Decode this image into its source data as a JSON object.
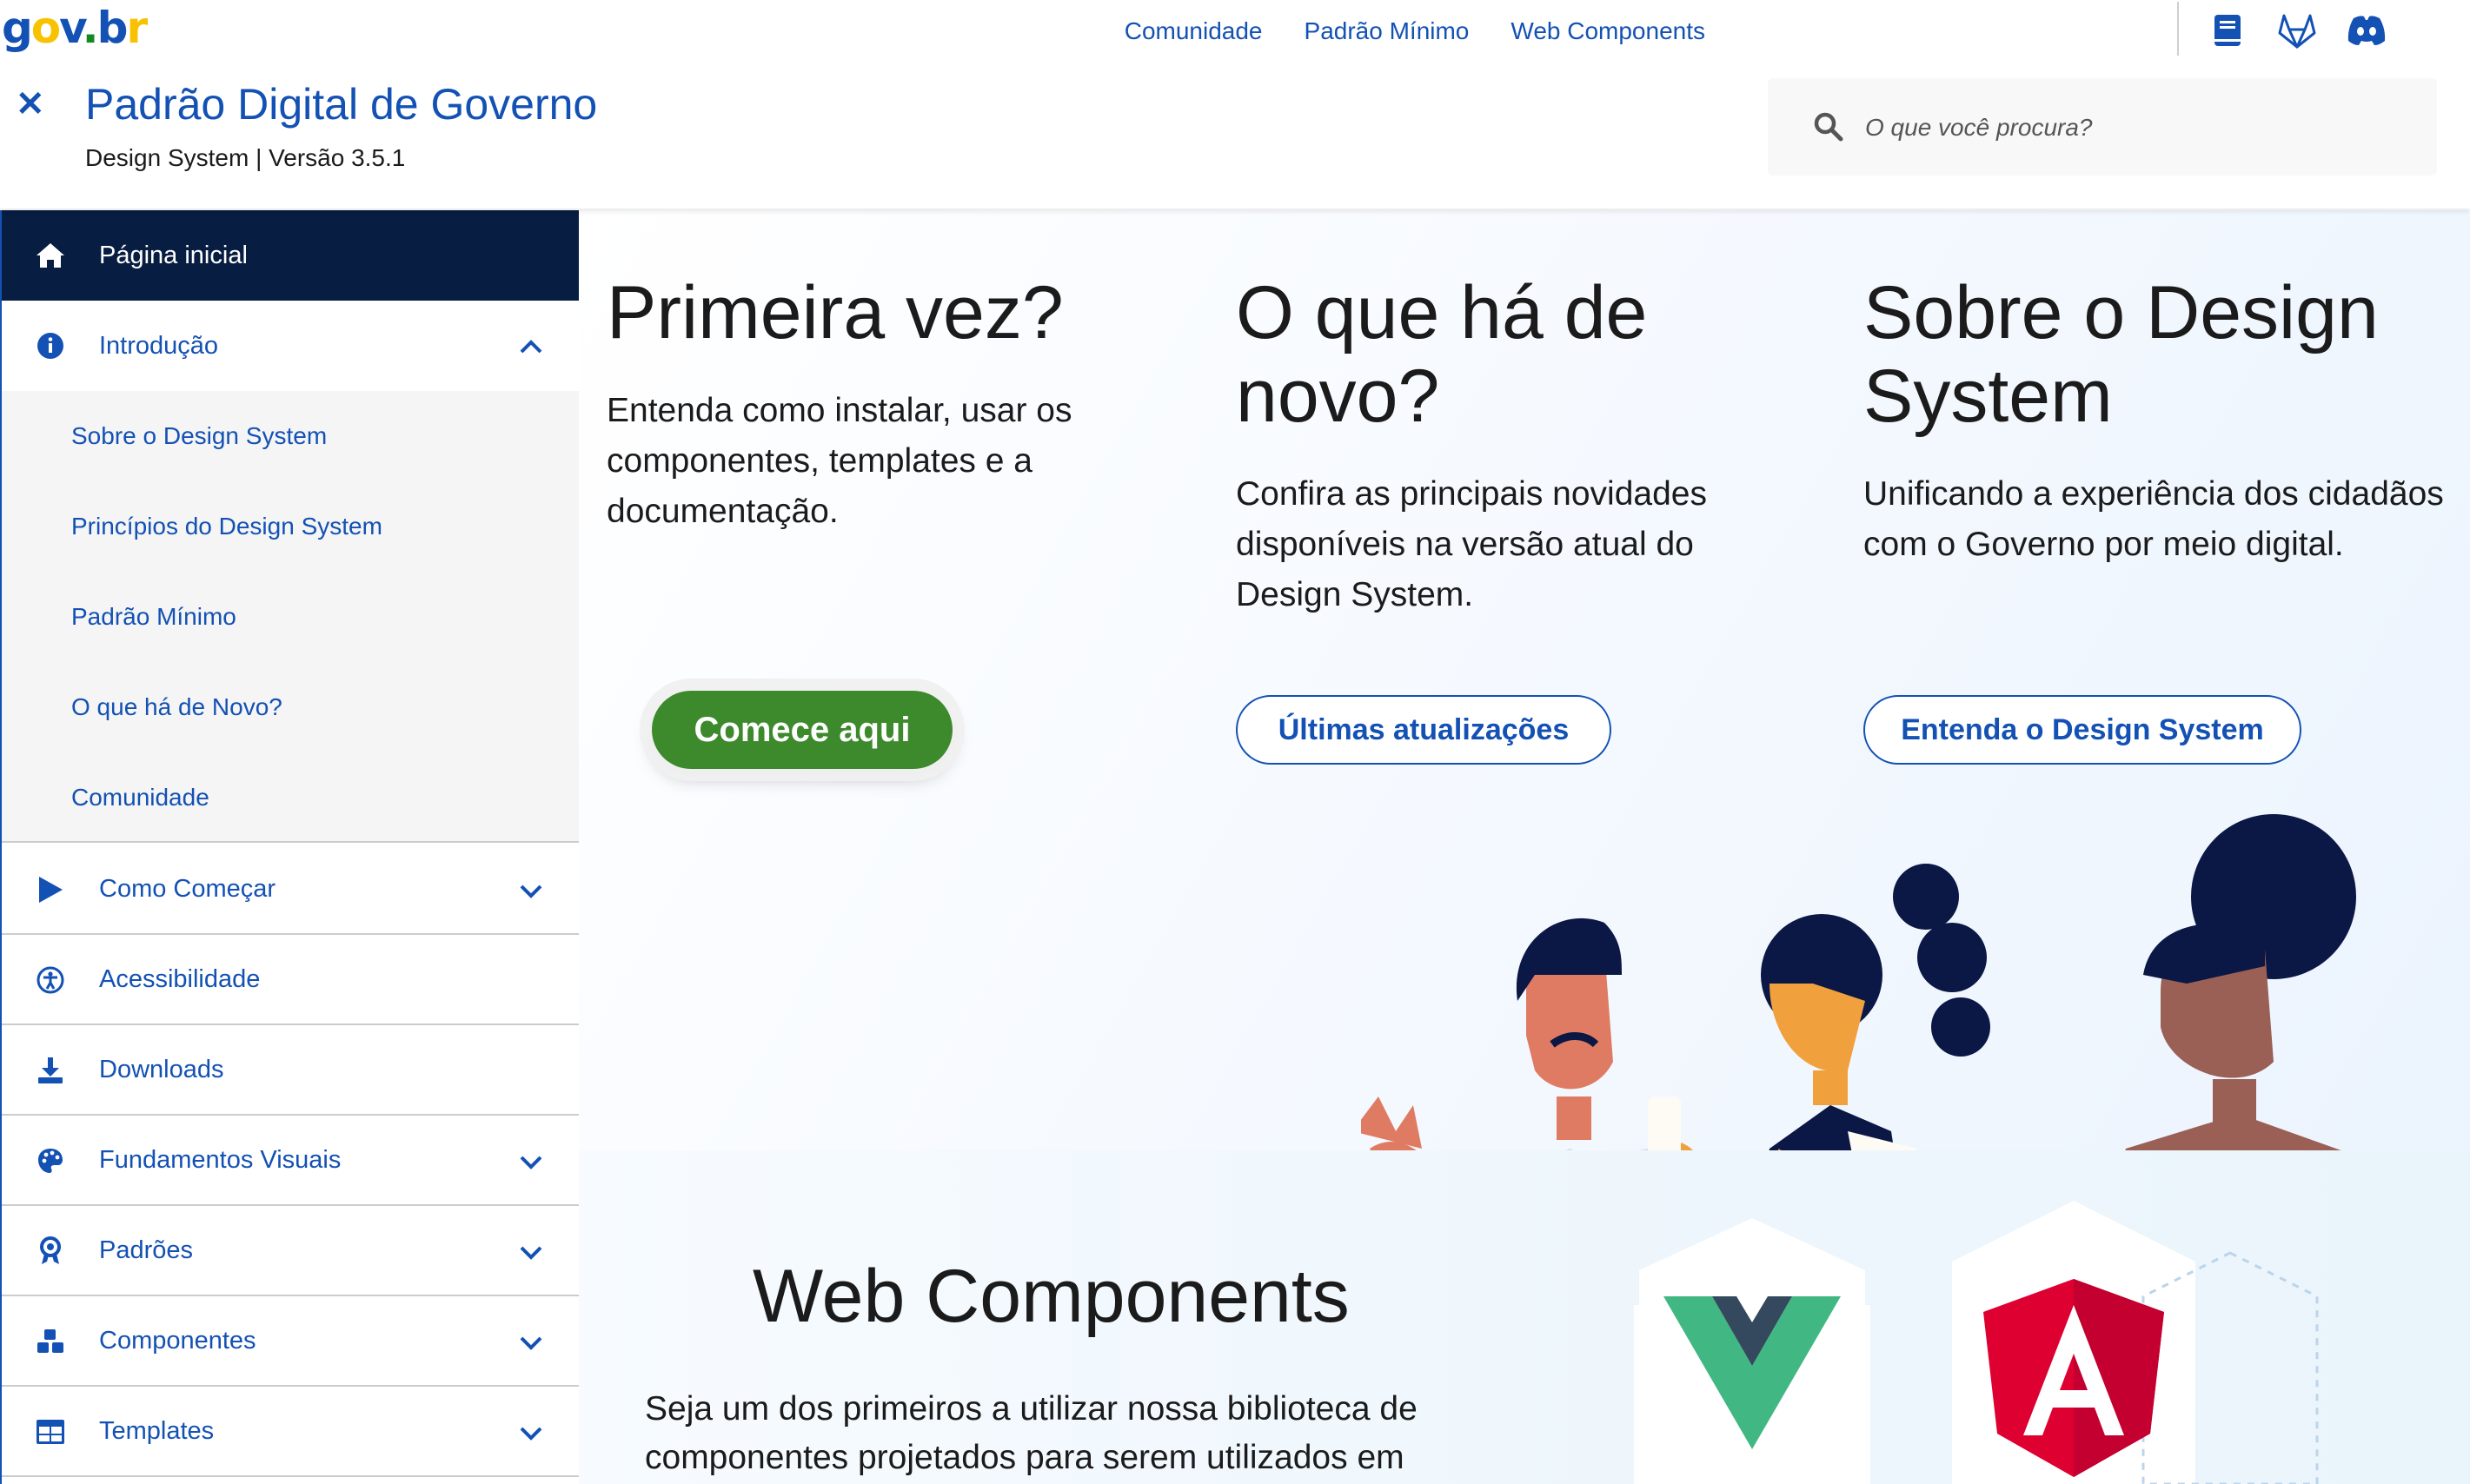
{
  "logo": {
    "text": "gov.br"
  },
  "top_nav": {
    "links": [
      "Comunidade",
      "Padrão Mínimo",
      "Web Components"
    ],
    "icons": [
      "book-icon",
      "gitlab-icon",
      "discord-icon"
    ]
  },
  "site": {
    "title": "Padrão Digital de Governo",
    "subtitle": "Design System | Versão 3.5.1"
  },
  "search": {
    "placeholder": "O que você procura?"
  },
  "sidebar": {
    "items": [
      {
        "label": "Página inicial",
        "icon": "home-icon"
      },
      {
        "label": "Introdução",
        "icon": "info-icon"
      },
      {
        "label": "Como Começar",
        "icon": "play-icon"
      },
      {
        "label": "Acessibilidade",
        "icon": "accessibility-icon"
      },
      {
        "label": "Downloads",
        "icon": "download-icon"
      },
      {
        "label": "Fundamentos Visuais",
        "icon": "palette-icon"
      },
      {
        "label": "Padrões",
        "icon": "award-icon"
      },
      {
        "label": "Componentes",
        "icon": "cubes-icon"
      },
      {
        "label": "Templates",
        "icon": "table-icon"
      }
    ],
    "intro_subitems": [
      "Sobre o Design System",
      "Princípios do Design System",
      "Padrão Mínimo",
      "O que há de Novo?",
      "Comunidade"
    ]
  },
  "hero": {
    "col1": {
      "title": "Primeira vez?",
      "text": "Entenda como instalar, usar os componentes, templates e a documentação.",
      "button": "Comece aqui"
    },
    "col2": {
      "title": "O que há de novo?",
      "text": "Confira as principais novidades disponíveis na versão atual do Design System.",
      "button": "Últimas atualizações"
    },
    "col3": {
      "title": "Sobre o Design System",
      "text": "Unificando a experiência dos cidadãos com o Governo por meio digital.",
      "button": "Entenda o Design System"
    }
  },
  "web_components": {
    "title": "Web Components",
    "text": "Seja um dos primeiros a utilizar nossa biblioteca de componentes projetados para serem utilizados em",
    "logos": [
      "vue-icon",
      "angular-icon"
    ]
  },
  "colors": {
    "primary": "#1351b4",
    "active_nav": "#071d41",
    "success": "#3d8a2d"
  }
}
